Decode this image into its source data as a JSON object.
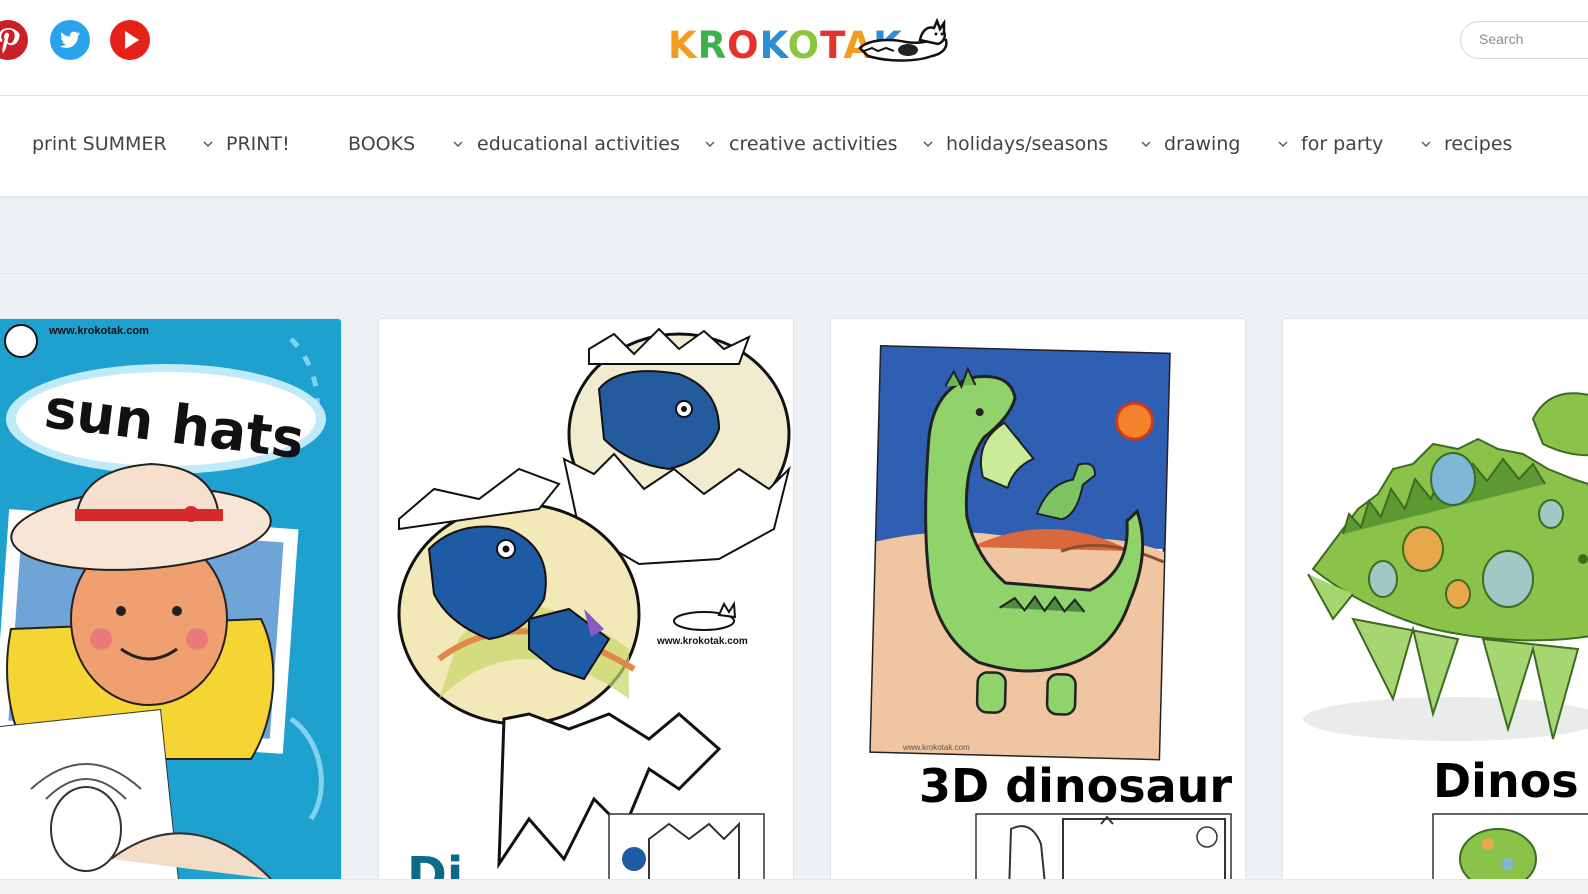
{
  "header": {
    "logo_text": "KROKOTAK",
    "logo_letter_colors": [
      "#f39c1f",
      "#3cb24a",
      "#e5322d",
      "#2b8fd6",
      "#8cc63f",
      "#e5322d",
      "#f39c1f",
      "#2b8fd6"
    ],
    "social_icons": [
      {
        "name": "pinterest-icon",
        "color": "#cb2027"
      },
      {
        "name": "twitter-icon",
        "color": "#2aa3ef"
      },
      {
        "name": "youtube-icon",
        "color": "#e62117"
      }
    ],
    "search_placeholder": "Search"
  },
  "nav": {
    "items": [
      {
        "label": "print SUMMER",
        "has_dropdown": false
      },
      {
        "label": "PRINT!",
        "has_dropdown": true
      },
      {
        "label": "BOOKS",
        "has_dropdown": false
      },
      {
        "label": "educational activities",
        "has_dropdown": true
      },
      {
        "label": "creative activities",
        "has_dropdown": true
      },
      {
        "label": "holidays/seasons",
        "has_dropdown": true
      },
      {
        "label": "drawing",
        "has_dropdown": true
      },
      {
        "label": "for party",
        "has_dropdown": true
      },
      {
        "label": "recipes",
        "has_dropdown": true
      }
    ]
  },
  "cards": [
    {
      "image_title": "sun hats",
      "watermark": "www.krokotak.com",
      "bg_color": "#1fa1cf"
    },
    {
      "image_title": "Di",
      "watermark": "www.krokotak.com"
    },
    {
      "image_title": "3D dinosaur",
      "watermark": "www.krokotak.com"
    },
    {
      "image_title": "Dinos",
      "watermark": ""
    }
  ]
}
